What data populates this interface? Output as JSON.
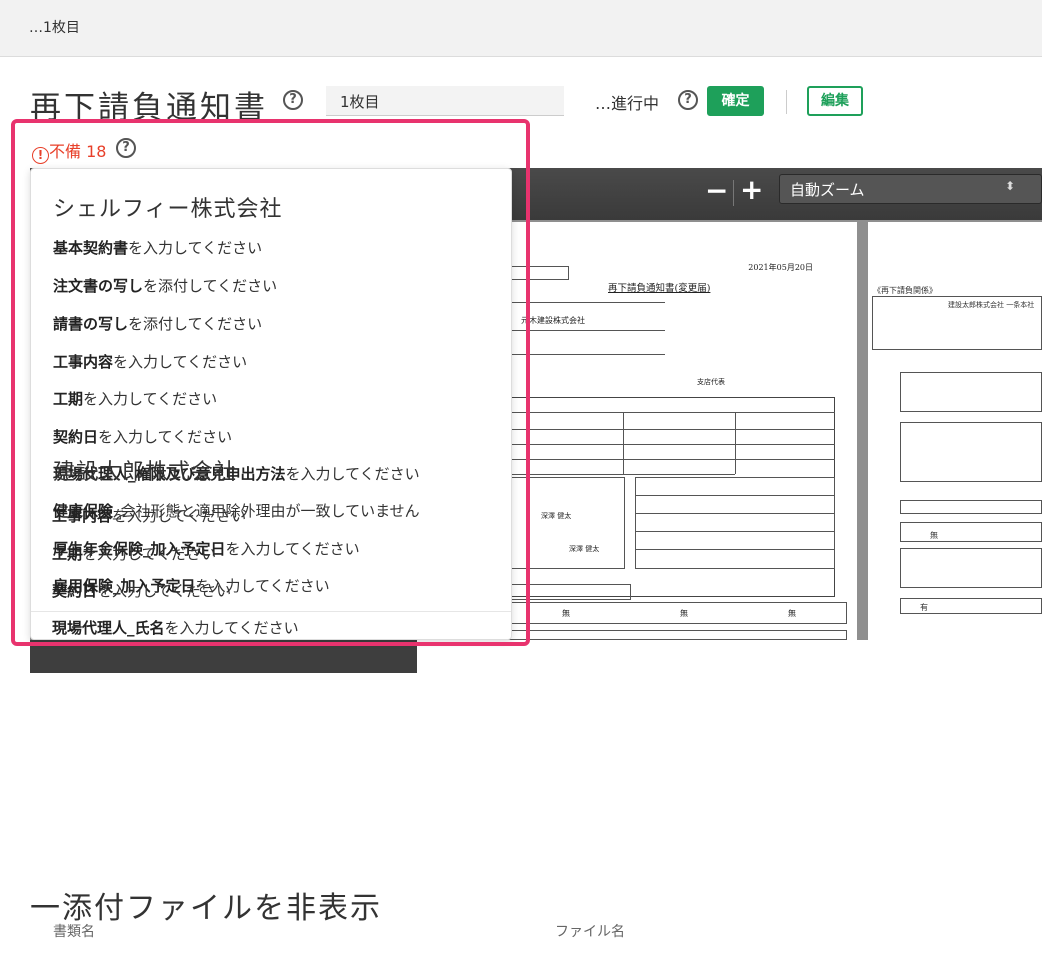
{
  "breadcrumb": "…1枚目",
  "header": {
    "title": "再下請負通知書",
    "count_value": "1枚目",
    "status": "…進行中",
    "confirm_label": "確定",
    "edit_label": "編集"
  },
  "warning": {
    "label": "不備",
    "count": "18"
  },
  "pdf_viewer": {
    "zoom_out": "−",
    "zoom_in": "+",
    "zoom_mode": "自動ズーム",
    "page1": {
      "date": "2021年05月20日",
      "title": "再下請負通知書(変更届)",
      "company": "元木建設株式会社",
      "representative": "支店代表",
      "person1": "深澤 健太",
      "person2": "深澤 健太",
      "none1": "無",
      "none2": "無",
      "none3": "無"
    },
    "page2": {
      "title": "《再下請負関係》",
      "company": "建設太郎株式会社 一条本社",
      "none": "無",
      "yes": "有"
    }
  },
  "issues": {
    "groups": [
      {
        "company": "シェルフィー株式会社",
        "items": [
          {
            "field": "基本契約書",
            "message": "を入力してください"
          },
          {
            "field": "注文書の写し",
            "message": "を添付してください"
          },
          {
            "field": "請書の写し",
            "message": "を添付してください"
          },
          {
            "field": "工事内容",
            "message": "を入力してください"
          },
          {
            "field": "工期",
            "message": "を入力してください"
          },
          {
            "field": "契約日",
            "message": "を入力してください"
          },
          {
            "field": "現場代理人_権限及び意見申出方法",
            "message": "を入力してください"
          },
          {
            "field": "健康保険",
            "message": "_会社形態と適用除外理由が一致していません"
          },
          {
            "field": "厚生年金保険_加入予定日",
            "message": "を入力してください"
          },
          {
            "field": "雇用保険_加入予定日",
            "message": "を入力してください"
          }
        ]
      },
      {
        "company": "建設太郎株式会社",
        "items": [
          {
            "field": "工事内容",
            "message": "を入力してください"
          },
          {
            "field": "工期",
            "message": "を入力してください"
          },
          {
            "field": "契約日",
            "message": "を入力してください"
          },
          {
            "field": "現場代理人_氏名",
            "message": "を入力してください"
          }
        ]
      }
    ]
  },
  "attachments": {
    "toggle_label": "一添付ファイルを非表示",
    "columns": [
      "書類名",
      "ファイル名"
    ]
  },
  "colors": {
    "accent_green": "#1ea05a",
    "warning_red": "#e8402a",
    "highlight_pink": "#e8336e"
  }
}
